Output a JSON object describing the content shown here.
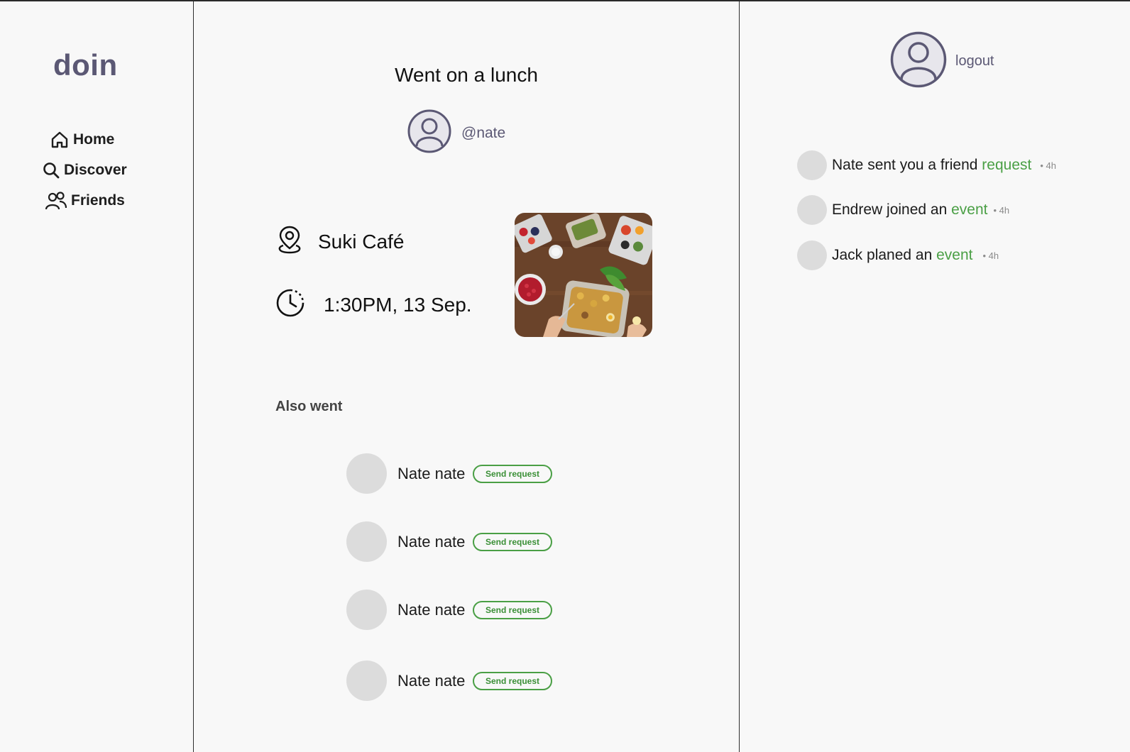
{
  "brand": "doin",
  "nav": [
    {
      "label": "Home",
      "icon": "home-icon"
    },
    {
      "label": "Discover",
      "icon": "search-icon"
    },
    {
      "label": "Friends",
      "icon": "friends-icon"
    }
  ],
  "post": {
    "title": "Went on a lunch",
    "handle": "@nate",
    "place": "Suki Café",
    "time": "1:30PM, 13 Sep.",
    "photo_icon": "food-photo"
  },
  "also_went": {
    "label": "Also went",
    "people": [
      {
        "name": "Nate nate",
        "button": "Send request"
      },
      {
        "name": "Nate nate",
        "button": "Send request"
      },
      {
        "name": "Nate nate",
        "button": "Send request"
      },
      {
        "name": "Nate nate",
        "button": "Send request"
      }
    ]
  },
  "header": {
    "logout": "logout"
  },
  "notifications": [
    {
      "text": "Nate sent you a friend ",
      "link": "request",
      "time": "• 4h"
    },
    {
      "text": "Endrew joined an ",
      "link": "event",
      "time": "• 4h"
    },
    {
      "text": "Jack planed an ",
      "link": "event",
      "time": "• 4h"
    }
  ],
  "colors": {
    "accent": "#4a9f45",
    "brand": "#5b5874",
    "avatar_placeholder": "#dcdcdc"
  }
}
